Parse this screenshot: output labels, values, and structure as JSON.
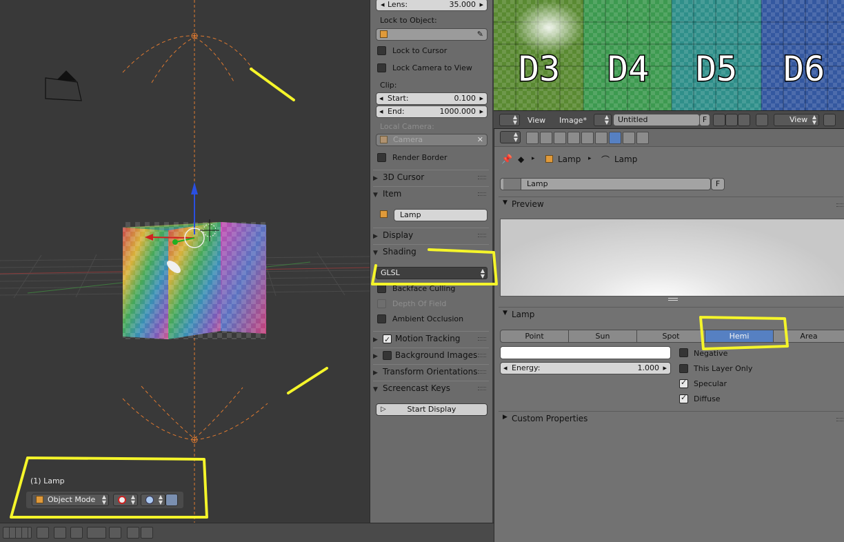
{
  "viewport": {
    "info": "(1) Lamp",
    "mode": "Object Mode"
  },
  "npanel": {
    "lens": {
      "label": "Lens:",
      "value": "35.000"
    },
    "lock_to_object": "Lock to Object:",
    "lock_to_cursor": "Lock to Cursor",
    "lock_camera_to_view": "Lock Camera to View",
    "clip": "Clip:",
    "clip_start": {
      "label": "Start:",
      "value": "0.100"
    },
    "clip_end": {
      "label": "End:",
      "value": "1000.000"
    },
    "local_camera": "Local Camera:",
    "camera_field": "Camera",
    "render_border": "Render Border",
    "cursor_3d": "3D Cursor",
    "item": "Item",
    "item_name": "Lamp",
    "display": "Display",
    "shading": "Shading",
    "shading_mode": "GLSL",
    "backface_culling": "Backface Culling",
    "depth_of_field": "Depth Of Field",
    "ambient_occlusion": "Ambient Occlusion",
    "motion_tracking": "Motion Tracking",
    "background_images": "Background Images",
    "transform_orientations": "Transform Orientations",
    "screencast_keys": "Screencast Keys",
    "start_display": "Start Display"
  },
  "image_editor": {
    "tiles": [
      "D3",
      "D4",
      "D5",
      "D6"
    ],
    "menu_view": "View",
    "menu_image": "Image*",
    "image_name": "Untitled",
    "fake_user": "F",
    "view_mode": "View"
  },
  "properties": {
    "breadcrumb": [
      "Lamp",
      "Lamp"
    ],
    "datablock_name": "Lamp",
    "datablock_f": "F",
    "preview": "Preview",
    "lamp_panel": "Lamp",
    "lamp_types": [
      "Point",
      "Sun",
      "Spot",
      "Hemi",
      "Area"
    ],
    "active_type": "Hemi",
    "negative": "Negative",
    "this_layer_only": "This Layer Only",
    "specular": "Specular",
    "diffuse": "Diffuse",
    "energy": {
      "label": "Energy:",
      "value": "1.000"
    },
    "custom_properties": "Custom Properties"
  },
  "colors": {
    "highlight": "#f5f52a",
    "active_blue": "#5680c2"
  }
}
